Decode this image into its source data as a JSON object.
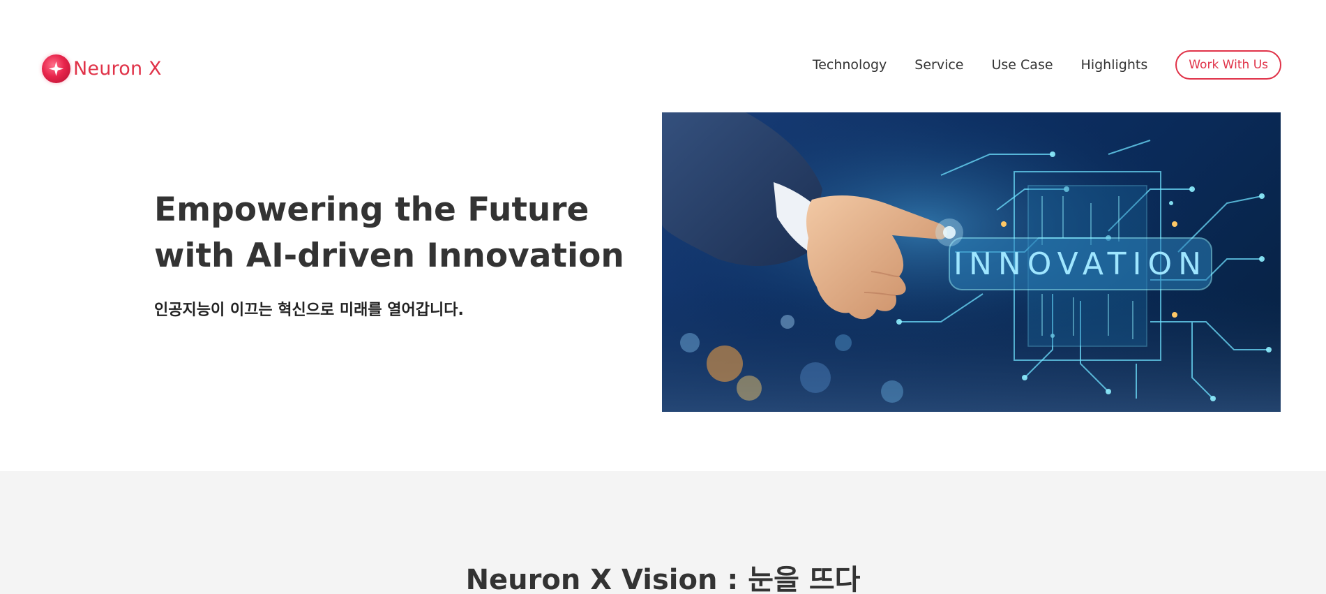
{
  "brand": {
    "name": "Neuron X",
    "accent_color": "#e03248"
  },
  "nav": {
    "items": [
      {
        "label": "Technology"
      },
      {
        "label": "Service"
      },
      {
        "label": "Use Case"
      },
      {
        "label": "Highlights"
      }
    ],
    "cta_label": "Work With Us"
  },
  "hero": {
    "title_line1": "Empowering the Future",
    "title_line2": "with AI-driven Innovation",
    "subtitle": "인공지능이 이끄는 혁신으로 미래를 열어갑니다.",
    "image": {
      "depicts": "hand-touching-circuit-icon",
      "overlay_word": "INNOVATION"
    }
  },
  "vision": {
    "title": "Neuron X Vision : 눈을 뜨다",
    "background_color": "#f4f4f4"
  }
}
